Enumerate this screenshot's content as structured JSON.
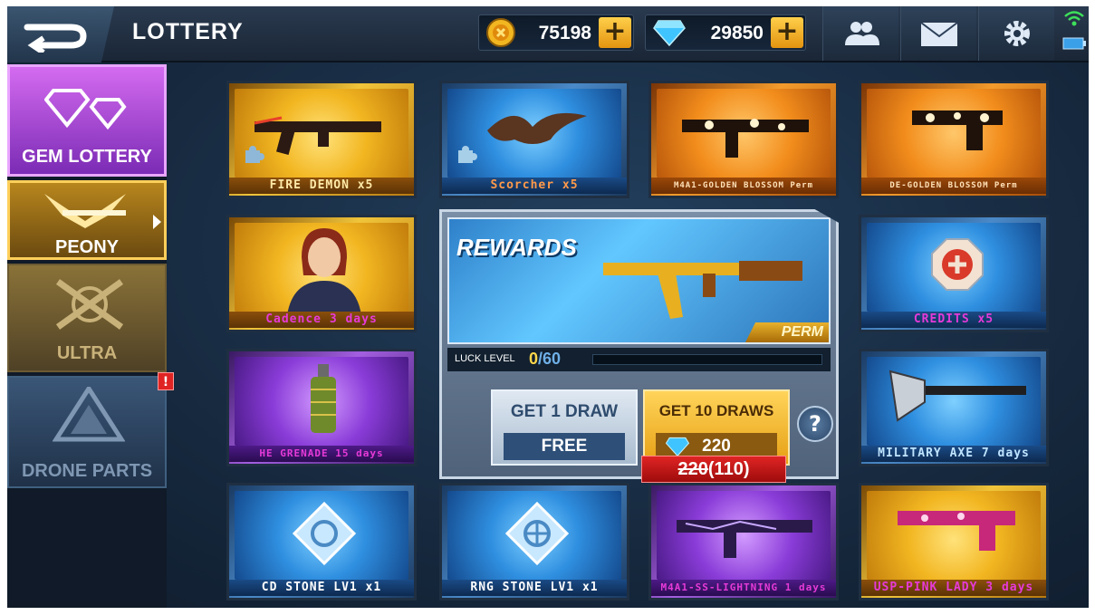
{
  "header": {
    "title": "LOTTERY",
    "gold_amount": "75198",
    "gem_amount": "29850",
    "plus_symbol": "+"
  },
  "sidebar": {
    "tabs": [
      {
        "label": "GEM LOTTERY",
        "state": "selected"
      },
      {
        "label": "PEONY",
        "state": "active"
      },
      {
        "label": "ULTRA",
        "state": "normal"
      },
      {
        "label": "DRONE PARTS",
        "state": "normal",
        "alert": "!"
      }
    ]
  },
  "tiles": [
    {
      "label": "FIRE DEMON x5",
      "rarity": "gold"
    },
    {
      "label": "Scorcher x5",
      "rarity": "blue"
    },
    {
      "label": "M4A1-GOLDEN BLOSSOM Perm",
      "rarity": "orange"
    },
    {
      "label": "DE-GOLDEN BLOSSOM Perm",
      "rarity": "orange"
    },
    {
      "label": "Cadence 3 days",
      "rarity": "gold"
    },
    {
      "label": "CREDITS x5",
      "rarity": "blue"
    },
    {
      "label": "HE GRENADE 15 days",
      "rarity": "purple"
    },
    {
      "label": "MILITARY AXE 7 days",
      "rarity": "blue"
    },
    {
      "label": "CD STONE LV1 x1",
      "rarity": "blue"
    },
    {
      "label": "RNG STONE LV1 x1",
      "rarity": "blue"
    },
    {
      "label": "M4A1-SS-LIGHTNING 1 days",
      "rarity": "purple"
    },
    {
      "label": "USP-PINK LADY 3 days",
      "rarity": "gold"
    }
  ],
  "rewards": {
    "title": "REWARDS",
    "badge": "PERM",
    "luck_label": "LUCK LEVEL",
    "luck_current": "0",
    "luck_max": "/60",
    "luck_progress": 0
  },
  "draws": {
    "single_label": "GET 1 DRAW",
    "single_price": "FREE",
    "ten_label": "GET 10 DRAWS",
    "ten_price": "220",
    "help": "?",
    "discount_old": "220",
    "discount_new": "(110)"
  },
  "colors": {
    "gold_currency": "#f2b621",
    "gem_currency": "#3fc4ff",
    "alert_red": "#e02424",
    "luck_yellow": "#ffd84a"
  }
}
